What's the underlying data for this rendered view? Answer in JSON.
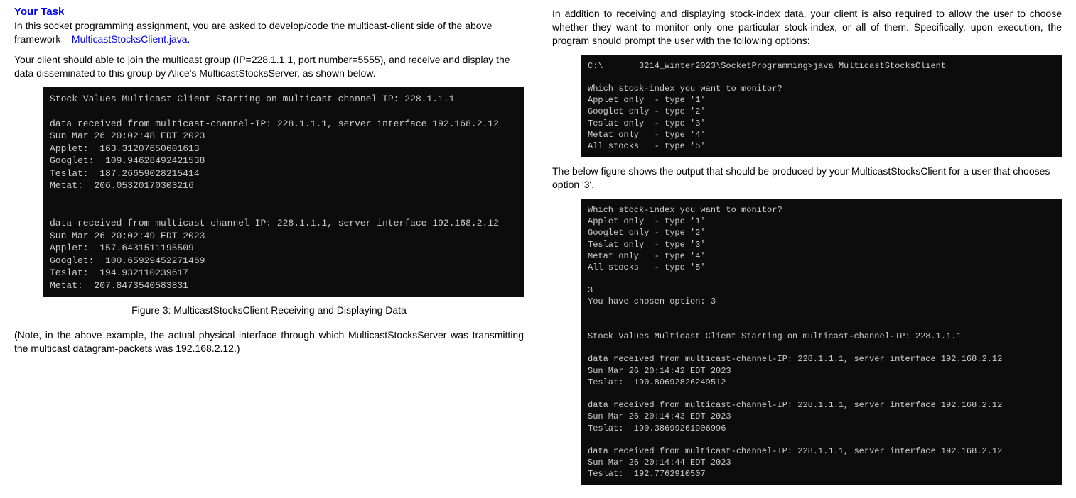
{
  "left": {
    "heading": "Your Task",
    "para1a": "In this socket programming assignment, you are asked to develop/code the multicast-client side of the above framework – ",
    "para1_link": "MulticastStocksClient.java",
    "para1b": ".",
    "para2": "Your client should able to join the multicast group (IP=228.1.1.1, port number=5555), and receive and display the data disseminated to this group by Alice's MulticastStocksServer, as shown below.",
    "terminal1": "Stock Values Multicast Client Starting on multicast-channel-IP: 228.1.1.1\n\ndata received from multicast-channel-IP: 228.1.1.1, server interface 192.168.2.12\nSun Mar 26 20:02:48 EDT 2023\nApplet:  163.31207650601613\nGooglet:  109.94628492421538\nTeslat:  187.26659028215414\nMetat:  206.05320170303216\n\n\ndata received from multicast-channel-IP: 228.1.1.1, server interface 192.168.2.12\nSun Mar 26 20:02:49 EDT 2023\nApplet:  157.6431511195509\nGooglet:  100.65929452271469\nTeslat:  194.932110239617\nMetat:  207.8473540583831",
    "caption1": "Figure 3:   MulticastStocksClient Receiving and Displaying Data",
    "note": "(Note, in the above example, the actual physical interface through which MulticastStocksServer was transmitting the multicast datagram-packets was 192.168.2.12.)"
  },
  "right": {
    "para1": "In addition to receiving and displaying stock-index data, your client is also required to allow the user to choose whether they want to monitor only one particular stock-index, or all of them. Specifically, upon execution, the program should prompt the user with the following options:",
    "terminal2": "C:\\       3214_Winter2023\\SocketProgramming>java MulticastStocksClient\n\nWhich stock-index you want to monitor?\nApplet only  - type '1'\nGooglet only - type '2'\nTeslat only  - type '3'\nMetat only   - type '4'\nAll stocks   - type '5'",
    "para2": "The below figure shows the output that should be produced by your MulticastStocksClient for a user that chooses option '3'.",
    "terminal3": "Which stock-index you want to monitor?\nApplet only  - type '1'\nGooglet only - type '2'\nTeslat only  - type '3'\nMetat only   - type '4'\nAll stocks   - type '5'\n\n3\nYou have chosen option: 3\n\n\nStock Values Multicast Client Starting on multicast-channel-IP: 228.1.1.1\n\ndata received from multicast-channel-IP: 228.1.1.1, server interface 192.168.2.12\nSun Mar 26 20:14:42 EDT 2023\nTeslat:  190.80692826249512\n\ndata received from multicast-channel-IP: 228.1.1.1, server interface 192.168.2.12\nSun Mar 26 20:14:43 EDT 2023\nTeslat:  190.38699261906996\n\ndata received from multicast-channel-IP: 228.1.1.1, server interface 192.168.2.12\nSun Mar 26 20:14:44 EDT 2023\nTeslat:  192.7762910507"
  }
}
